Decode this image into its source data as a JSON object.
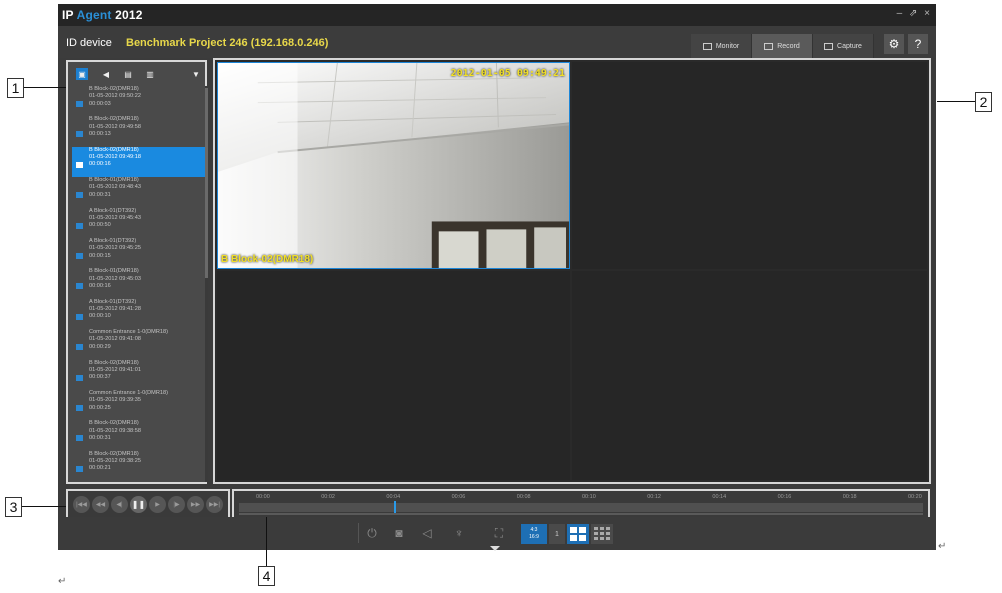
{
  "app": {
    "title_prefix": "IP",
    "title_agent": "Agent",
    "title_year": "2012",
    "window_controls": {
      "minimize": "–",
      "restore": "⇗",
      "close": "×"
    }
  },
  "header": {
    "id_label": "ID  device",
    "device_name": "Benchmark Project  246 (192.168.0.246)",
    "tabs": [
      {
        "label": "Monitor",
        "icon": "monitor-icon"
      },
      {
        "label": "Record",
        "icon": "record-icon",
        "active": true
      },
      {
        "label": "Capture",
        "icon": "capture-icon"
      }
    ],
    "settings_glyph": "⚙",
    "help_glyph": "?"
  },
  "sidebar": {
    "toolbar": [
      {
        "icon": "video-list-icon",
        "glyph": "▣",
        "active": true
      },
      {
        "icon": "audio-icon",
        "glyph": "◀"
      },
      {
        "icon": "export-icon",
        "glyph": "▤"
      },
      {
        "icon": "delete-icon",
        "glyph": "▥"
      }
    ],
    "filter_glyph": "▼",
    "recordings": [
      {
        "name": "B Block-02(DMR18)",
        "datetime": "01-05-2012 09:50:22",
        "duration": "00:00:03"
      },
      {
        "name": "B Block-02(DMR18)",
        "datetime": "01-05-2012 09:49:58",
        "duration": "00:00:13"
      },
      {
        "name": "B Block-02(DMR18)",
        "datetime": "01-05-2012 09:49:18",
        "duration": "00:00:16",
        "selected": true
      },
      {
        "name": "B Block-01(DMR18)",
        "datetime": "01-05-2012 09:48:43",
        "duration": "00:00:31"
      },
      {
        "name": "A Block-01(DT392)",
        "datetime": "01-05-2012 09:45:43",
        "duration": "00:00:50"
      },
      {
        "name": "A Block-01(DT392)",
        "datetime": "01-05-2012 09:45:25",
        "duration": "00:00:15"
      },
      {
        "name": "B Block-01(DMR18)",
        "datetime": "01-05-2012 09:45:03",
        "duration": "00:00:16"
      },
      {
        "name": "A Block-01(DT392)",
        "datetime": "01-05-2012 09:41:28",
        "duration": "00:00:10"
      },
      {
        "name": "Common Entrance 1-0(DMR18)",
        "datetime": "01-05-2012 09:41:08",
        "duration": "00:00:29"
      },
      {
        "name": "B Block-02(DMR18)",
        "datetime": "01-05-2012 09:41:01",
        "duration": "00:00:37"
      },
      {
        "name": "Common Entrance 1-0(DMR18)",
        "datetime": "01-05-2012 09:39:35",
        "duration": "00:00:25"
      },
      {
        "name": "B Block-02(DMR18)",
        "datetime": "01-05-2012 09:38:58",
        "duration": "00:00:31"
      },
      {
        "name": "B Block-02(DMR18)",
        "datetime": "01-05-2012 09:38:25",
        "duration": "00:00:21"
      }
    ]
  },
  "video": {
    "timestamp": "2012-01-05 09:49:21",
    "camera_label": "B Block-02(DMR18)"
  },
  "playback": {
    "buttons": [
      {
        "name": "first-button",
        "glyph": "|◀◀"
      },
      {
        "name": "rewind-button",
        "glyph": "◀◀"
      },
      {
        "name": "step-back-button",
        "glyph": "◀|"
      },
      {
        "name": "pause-button",
        "glyph": "❚❚",
        "active": true
      },
      {
        "name": "play-button",
        "glyph": "▶"
      },
      {
        "name": "step-forward-button",
        "glyph": "|▶"
      },
      {
        "name": "fast-forward-button",
        "glyph": "▶▶"
      },
      {
        "name": "last-button",
        "glyph": "▶▶|"
      }
    ]
  },
  "timeline": {
    "ticks": [
      "00:00",
      "00:02",
      "00:04",
      "00:06",
      "00:08",
      "00:10",
      "00:12",
      "00:14",
      "00:16",
      "00:18",
      "00:20"
    ],
    "position_fraction": 0.19
  },
  "bottom_toolbar": {
    "power_glyph": "⏻",
    "snapshot_glyph": "◙",
    "speaker_glyph": "◁",
    "mic_glyph": "♆",
    "fullscreen_glyph": "⛶",
    "aspect_top": "4:3",
    "aspect_bottom": "16:9",
    "layout_single": "1"
  },
  "callouts": [
    "1",
    "2",
    "3",
    "4"
  ],
  "colors": {
    "accent_blue": "#1a8ae0",
    "overlay_yellow": "#f2e026",
    "device_yellow": "#e8d84a"
  }
}
